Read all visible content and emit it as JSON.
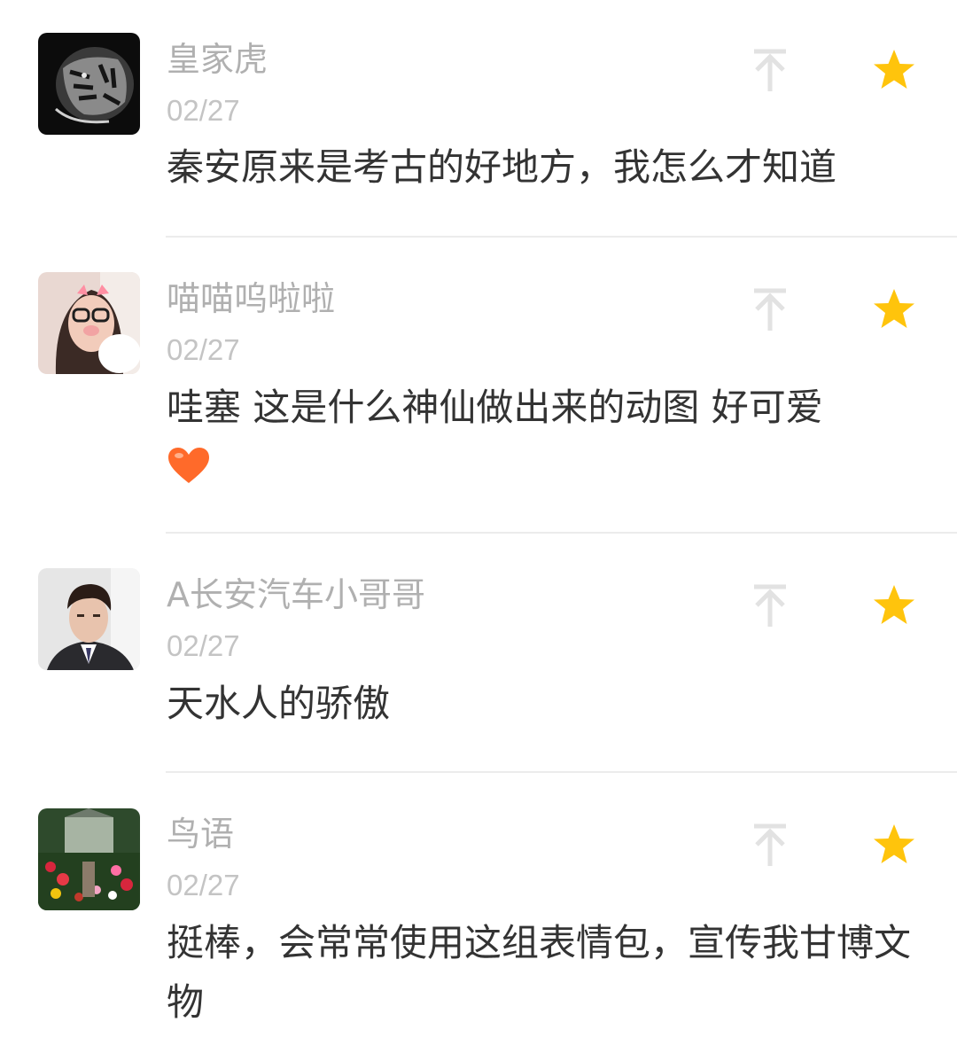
{
  "comments": [
    {
      "username": "皇家虎",
      "date": "02/27",
      "text": "秦安原来是考古的好地方，我怎么才知道",
      "avatar": "tiger-avatar",
      "emoji": ""
    },
    {
      "username": "喵喵呜啦啦",
      "date": "02/27",
      "text": "哇塞 这是什么神仙做出来的动图 好可爱",
      "avatar": "girl-avatar",
      "emoji": "orange-heart-icon"
    },
    {
      "username": "A长安汽车小哥哥",
      "date": "02/27",
      "text": "天水人的骄傲",
      "avatar": "man-avatar",
      "emoji": ""
    },
    {
      "username": "鸟语",
      "date": "02/27",
      "text": "挺棒，会常常使用这组表情包，宣传我甘博文物",
      "avatar": "flowers-avatar",
      "emoji": ""
    }
  ],
  "icons": {
    "pin": "pin-to-top-icon",
    "star": "star-icon"
  },
  "colors": {
    "star": "#ffc40c",
    "pin": "#e2e2e2",
    "username": "#b0b0b0",
    "date": "#c4c4c4",
    "text": "#333333",
    "heart": "#ff6a2a"
  }
}
